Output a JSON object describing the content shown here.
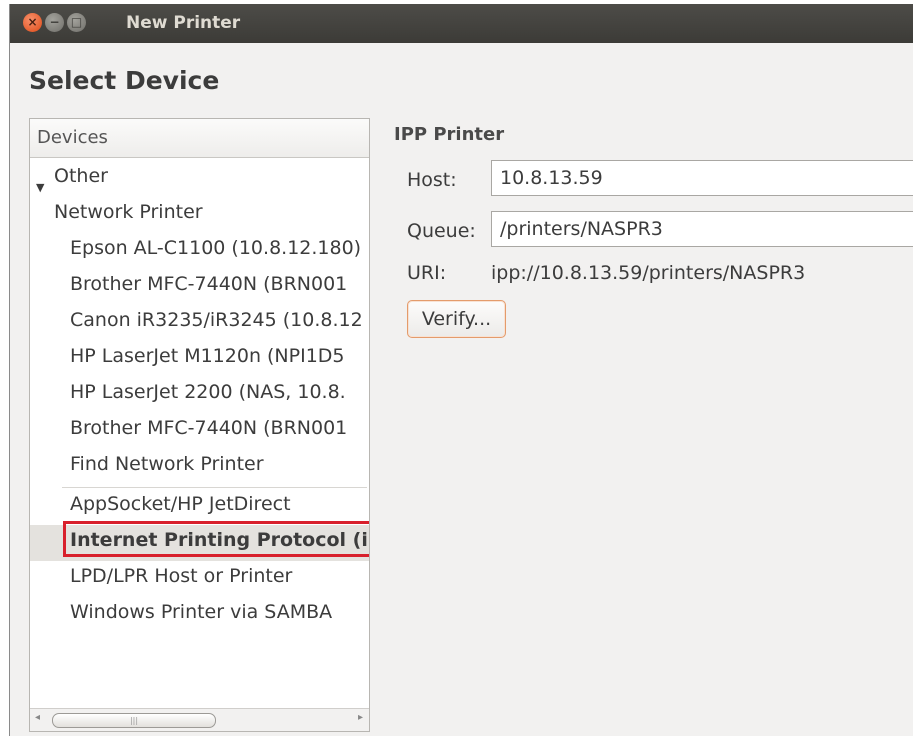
{
  "window": {
    "title": "New Printer",
    "close_glyph": "×",
    "min_glyph": "−",
    "max_glyph": "□"
  },
  "heading": "Select Device",
  "devices": {
    "header": "Devices",
    "expander_glyph": "▼",
    "items": [
      {
        "label": "Other"
      },
      {
        "label": "Network Printer"
      },
      {
        "label": "Epson AL-C1100 (10.8.12.180)"
      },
      {
        "label": "Brother MFC-7440N (BRN001"
      },
      {
        "label": "Canon iR3235/iR3245 (10.8.12"
      },
      {
        "label": "HP LaserJet M1120n (NPI1D5"
      },
      {
        "label": "HP LaserJet 2200 (NAS, 10.8."
      },
      {
        "label": "Brother MFC-7440N (BRN001"
      },
      {
        "label": "Find Network Printer"
      },
      {
        "label": "AppSocket/HP JetDirect"
      },
      {
        "label": "Internet Printing Protocol (ip"
      },
      {
        "label": "LPD/LPR Host or Printer"
      },
      {
        "label": "Windows Printer via SAMBA"
      }
    ],
    "selected": "Internet Printing Protocol (ip",
    "scroll": {
      "left_arrow": "◂",
      "right_arrow": "▸",
      "thumb_grip": "|||"
    }
  },
  "ipp": {
    "title": "IPP Printer",
    "host_label": "Host:",
    "host_value": "10.8.13.59",
    "queue_label": "Queue:",
    "queue_value": "/printers/NASPR3",
    "uri_label": "URI:",
    "uri_value": "ipp://10.8.13.59/printers/NASPR3",
    "verify_label": "Verify..."
  },
  "colors": {
    "titlebar": "#3c3b37",
    "close_button": "#df4a16",
    "selection_highlight": "#d8202c",
    "verify_border": "#e49b6b"
  }
}
